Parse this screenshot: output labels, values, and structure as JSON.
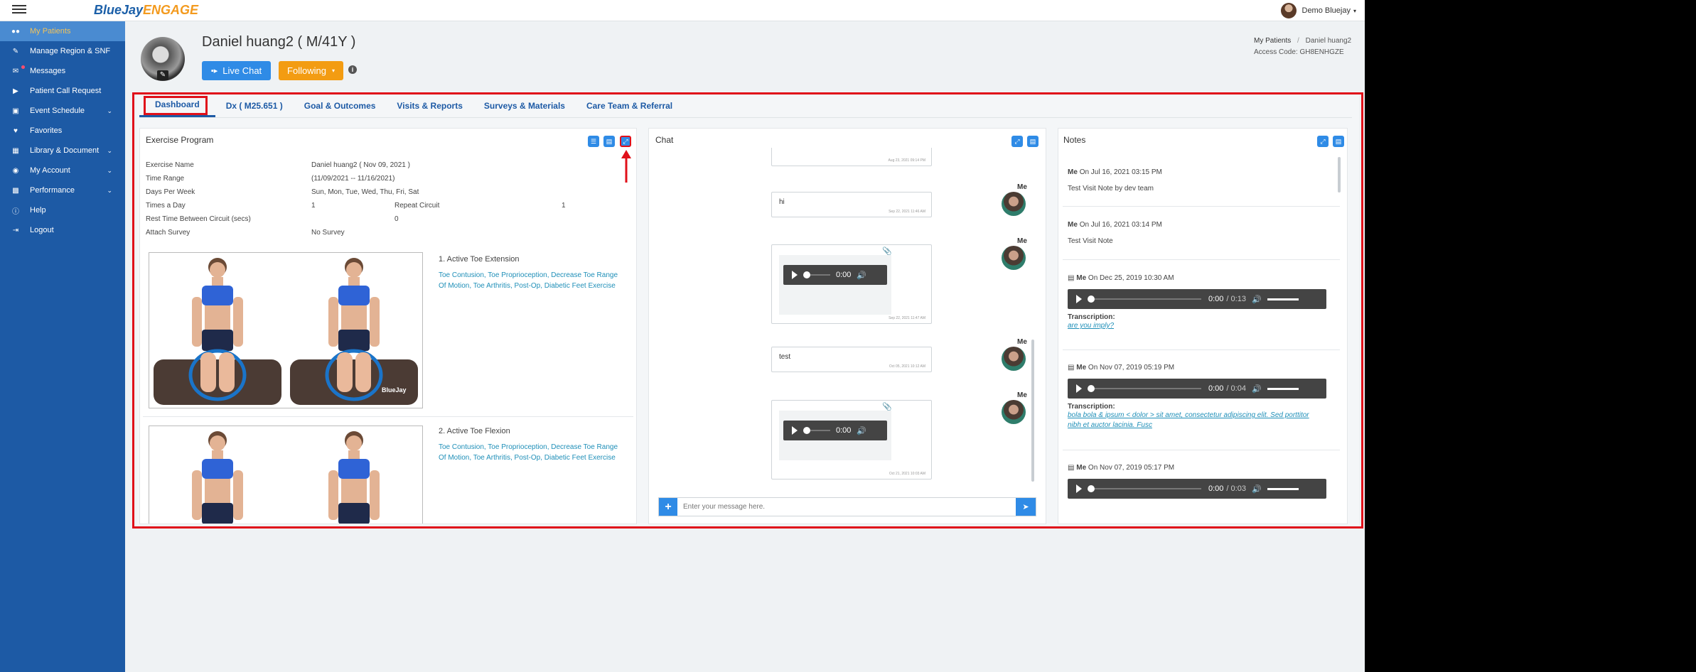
{
  "brand": {
    "logo_part1": "BlueJay",
    "logo_part2": "ENGAGE"
  },
  "user": {
    "name": "Demo Bluejay",
    "caret": "▾"
  },
  "sidebar": {
    "items": [
      {
        "label": "My Patients",
        "icon": "users-icon"
      },
      {
        "label": "Manage Region & SNF",
        "icon": "edit-icon"
      },
      {
        "label": "Messages",
        "icon": "chat-icon"
      },
      {
        "label": "Patient Call Request",
        "icon": "video-icon"
      },
      {
        "label": "Event Schedule",
        "icon": "calendar-icon"
      },
      {
        "label": "Favorites",
        "icon": "heart-icon"
      },
      {
        "label": "Library & Document",
        "icon": "book-icon"
      },
      {
        "label": "My Account",
        "icon": "user-circle-icon"
      },
      {
        "label": "Performance",
        "icon": "chart-icon"
      },
      {
        "label": "Help",
        "icon": "info-icon"
      },
      {
        "label": "Logout",
        "icon": "logout-icon"
      }
    ]
  },
  "patient": {
    "name": "Daniel huang2 ( M/41Y )",
    "live_chat": "Live Chat",
    "following": "Following",
    "breadcrumb_root": "My Patients",
    "breadcrumb_sep": "/",
    "breadcrumb_current": "Daniel huang2",
    "access_code": "Access Code: GH8ENHGZE"
  },
  "tabs": [
    {
      "label": "Dashboard"
    },
    {
      "label": "Dx ( M25.651 )"
    },
    {
      "label": "Goal & Outcomes"
    },
    {
      "label": "Visits & Reports"
    },
    {
      "label": "Surveys & Materials"
    },
    {
      "label": "Care Team & Referral"
    }
  ],
  "exercise": {
    "title": "Exercise Program",
    "rows": [
      {
        "label": "Exercise Name",
        "value": "Daniel huang2 ( Nov 09, 2021 )"
      },
      {
        "label": "Time Range",
        "value": "(11/09/2021 -- 11/16/2021)"
      },
      {
        "label": "Days Per Week",
        "value": "Sun, Mon, Tue, Wed, Thu, Fri, Sat"
      }
    ],
    "times_label": "Times a Day",
    "times_value": "1",
    "repeat_label": "Repeat Circuit",
    "repeat_value": "1",
    "rest_label": "Rest Time Between Circuit (secs)",
    "rest_value": "0",
    "survey_label": "Attach Survey",
    "survey_value": "No Survey",
    "items": [
      {
        "name": "1. Active Toe Extension",
        "tags": "Toe Contusion, Toe Proprioception, Decrease Toe Range Of Motion, Toe Arthritis, Post-Op, Diabetic Feet Exercise",
        "watermark": "BlueJay"
      },
      {
        "name": "2. Active Toe Flexion",
        "tags": "Toe Contusion, Toe Proprioception, Decrease Toe Range Of Motion, Toe Arthritis, Post-Op, Diabetic Feet Exercise"
      }
    ]
  },
  "chat": {
    "title": "Chat",
    "sender": "Me",
    "messages": [
      {
        "text": "",
        "ts": "Aug 23, 2021 09:14 PM"
      },
      {
        "text": "hi",
        "ts": "Sep 22, 2021 11:46 AM"
      },
      {
        "text": "",
        "ts": "Sep 22, 2021 11:47 AM",
        "audio": "0:00"
      },
      {
        "text": "test",
        "ts": "Oct 05, 2021 10:12 AM"
      },
      {
        "text": "",
        "ts": "Oct 21, 2021 10:03 AM",
        "audio": "0:00"
      }
    ],
    "placeholder": "Enter your message here."
  },
  "notes": {
    "title": "Notes",
    "author": "Me",
    "transcription_label": "Transcription:",
    "items": [
      {
        "when": "On Jul 16, 2021 03:15 PM",
        "text": "Test Visit Note by dev team"
      },
      {
        "when": "On Jul 16, 2021 03:14 PM",
        "text": "Test Visit Note"
      },
      {
        "when": "On Dec 25, 2019 10:30 AM",
        "cur": "0:00",
        "dur": "/ 0:13",
        "trans": "are you imply?"
      },
      {
        "when": "On Nov 07, 2019 05:19 PM",
        "cur": "0:00",
        "dur": "/ 0:04",
        "trans": "bola bola & ipsum < dolor > sit amet, consectetur adipiscing elit. Sed porttitor nibh et auctor lacinia. Fusc"
      },
      {
        "when": "On Nov 07, 2019 05:17 PM",
        "cur": "0:00",
        "dur": "/ 0:03"
      }
    ]
  },
  "colors": {
    "brand_blue": "#1d5aa5",
    "accent_orange": "#f39c12",
    "highlight_red": "#e0101a",
    "link_blue": "#2f8be6"
  }
}
